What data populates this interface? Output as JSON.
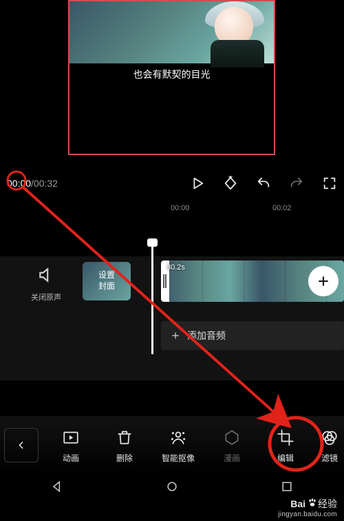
{
  "preview": {
    "subtitle": "也会有默契的目光"
  },
  "playback": {
    "current": "00:00",
    "total": "00:32"
  },
  "ruler": {
    "marks": [
      "00:00",
      "00:02"
    ]
  },
  "timeline": {
    "mute_label": "关闭原声",
    "cover_button": {
      "line1": "设置",
      "line2": "封面"
    },
    "clip_duration": "30.2s",
    "add_audio_label": "添加音频"
  },
  "toolbar": {
    "items": [
      {
        "name": "animation",
        "label": "动画"
      },
      {
        "name": "delete",
        "label": "删除"
      },
      {
        "name": "cutout",
        "label": "智能抠像"
      },
      {
        "name": "comic",
        "label": "漫画",
        "dim": true
      },
      {
        "name": "edit",
        "label": "编辑"
      },
      {
        "name": "filter",
        "label": "滤镜"
      }
    ]
  },
  "watermark": {
    "brand_prefix": "Bai",
    "brand_suffix": "经验",
    "url": "jingyan.baidu.com"
  },
  "annotation": {
    "color": "#e2231a"
  }
}
